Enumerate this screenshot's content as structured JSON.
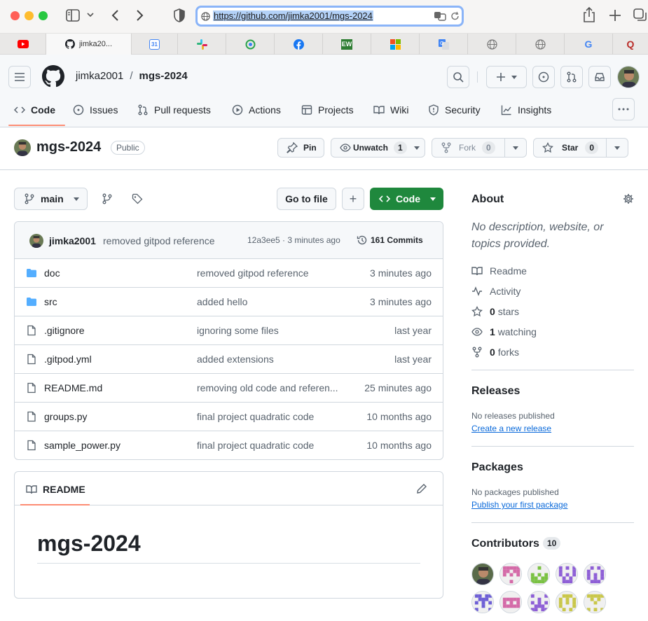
{
  "browser": {
    "url": "https://github.com/jimka2001/mgs-2024",
    "tabs": [
      {
        "icon": "youtube-icon",
        "label": "",
        "color": "#ff0000"
      },
      {
        "icon": "github-icon",
        "label": "jimka20...",
        "active": true
      },
      {
        "icon": "calendar-icon",
        "label": "31",
        "color": "#4285f4"
      },
      {
        "icon": "slack-icon",
        "label": ""
      },
      {
        "icon": "app-icon",
        "label": ""
      },
      {
        "icon": "facebook-icon",
        "label": "",
        "color": "#1877f2"
      },
      {
        "icon": "ew-icon",
        "label": "EW",
        "color": "#2e7d32"
      },
      {
        "icon": "microsoft-icon",
        "label": ""
      },
      {
        "icon": "translate-icon",
        "label": ""
      },
      {
        "icon": "globe-icon",
        "label": ""
      },
      {
        "icon": "globe-icon",
        "label": ""
      },
      {
        "icon": "google-icon",
        "label": "G"
      },
      {
        "icon": "quora-icon",
        "label": "Q",
        "color": "#b92b27"
      }
    ]
  },
  "header": {
    "owner": "jimka2001",
    "separator": "/",
    "repo": "mgs-2024"
  },
  "nav": {
    "tabs": [
      "Code",
      "Issues",
      "Pull requests",
      "Actions",
      "Projects",
      "Wiki",
      "Security",
      "Insights"
    ],
    "active": "Code"
  },
  "repo": {
    "name": "mgs-2024",
    "visibility": "Public",
    "pin_label": "Pin",
    "unwatch_label": "Unwatch",
    "watch_count": "1",
    "fork_label": "Fork",
    "fork_count": "0",
    "star_label": "Star",
    "star_count": "0"
  },
  "toolbar": {
    "branch": "main",
    "go_to_file": "Go to file",
    "add": "+",
    "code": "Code"
  },
  "commit": {
    "author": "jimka2001",
    "message": "removed gitpod reference",
    "hash_time": "12a3ee5 · 3 minutes ago",
    "commits": "161 Commits"
  },
  "files": [
    {
      "type": "folder",
      "name": "doc",
      "message": "removed gitpod reference",
      "time": "3 minutes ago"
    },
    {
      "type": "folder",
      "name": "src",
      "message": "added hello",
      "time": "3 minutes ago"
    },
    {
      "type": "file",
      "name": ".gitignore",
      "message": "ignoring some files",
      "time": "last year"
    },
    {
      "type": "file",
      "name": ".gitpod.yml",
      "message": "added extensions",
      "time": "last year"
    },
    {
      "type": "file",
      "name": "README.md",
      "message": "removing old code and referen...",
      "time": "25 minutes ago"
    },
    {
      "type": "file",
      "name": "groups.py",
      "message": "final project quadratic code",
      "time": "10 months ago"
    },
    {
      "type": "file",
      "name": "sample_power.py",
      "message": "final project quadratic code",
      "time": "10 months ago"
    }
  ],
  "readme": {
    "tab_label": "README",
    "title": "mgs-2024"
  },
  "about": {
    "title": "About",
    "description": "No description, website, or topics provided.",
    "items": [
      {
        "icon": "book-icon",
        "count": "",
        "label": "Readme"
      },
      {
        "icon": "pulse-icon",
        "count": "",
        "label": "Activity"
      },
      {
        "icon": "star-icon",
        "count": "0",
        "label": "stars"
      },
      {
        "icon": "eye-icon",
        "count": "1",
        "label": "watching"
      },
      {
        "icon": "fork-icon",
        "count": "0",
        "label": "forks"
      }
    ]
  },
  "releases": {
    "title": "Releases",
    "empty": "No releases published",
    "link": "Create a new release"
  },
  "packages": {
    "title": "Packages",
    "empty": "No packages published",
    "link": "Publish your first package"
  },
  "contributors": {
    "title": "Contributors",
    "count": "10",
    "avatar_colors": [
      "#5a6b4a",
      "#d46aa8",
      "#7ac143",
      "#8e5fd6",
      "#8e5fd6",
      "#6e5fd6",
      "#d46aa8",
      "#8e5fd6",
      "#c9c74a",
      "#c9c74a"
    ]
  }
}
